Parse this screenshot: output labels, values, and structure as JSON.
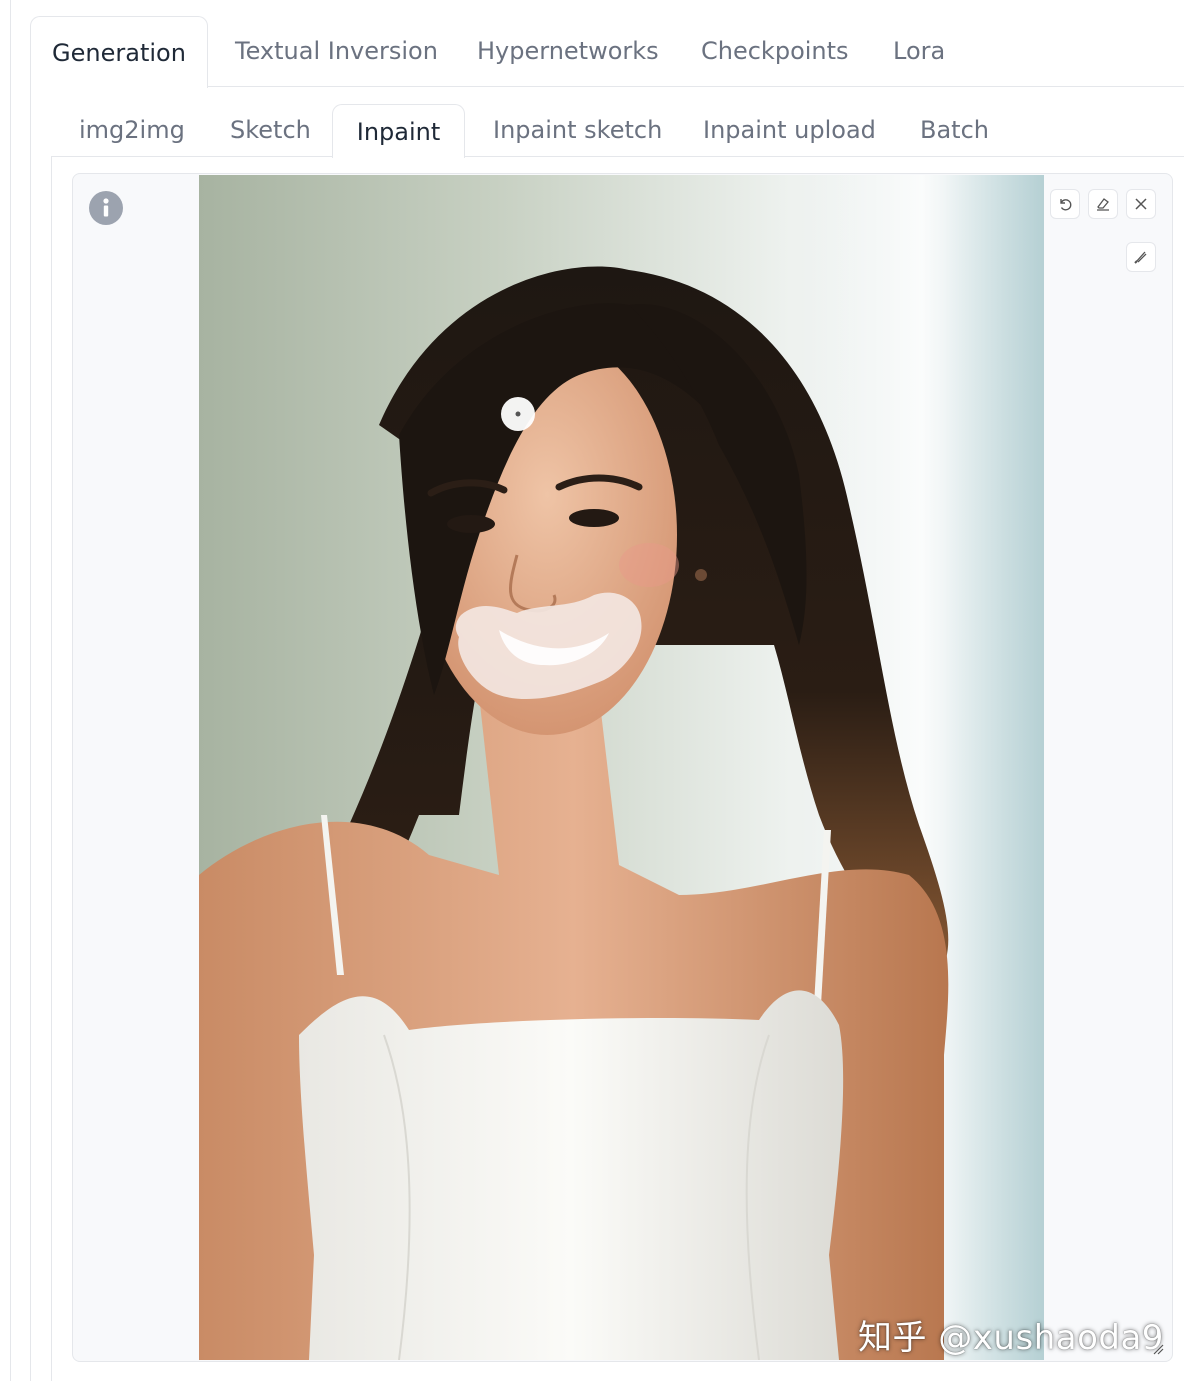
{
  "top_tabs": [
    {
      "label": "Generation",
      "active": true
    },
    {
      "label": "Textual Inversion",
      "active": false
    },
    {
      "label": "Hypernetworks",
      "active": false
    },
    {
      "label": "Checkpoints",
      "active": false
    },
    {
      "label": "Lora",
      "active": false
    }
  ],
  "sub_tabs": [
    {
      "label": "img2img",
      "active": false
    },
    {
      "label": "Sketch",
      "active": false
    },
    {
      "label": "Inpaint",
      "active": true
    },
    {
      "label": "Inpaint sketch",
      "active": false
    },
    {
      "label": "Inpaint upload",
      "active": false
    },
    {
      "label": "Batch",
      "active": false
    }
  ],
  "editor": {
    "toolbar_icons": [
      "undo-icon",
      "eraser-icon",
      "close-icon"
    ],
    "brush_icon": "brush-icon",
    "info_icon": "info-icon"
  },
  "watermark": "知乎 @xushaoda9",
  "colors": {
    "active_text": "#1f2937",
    "inactive_text": "#6b7280",
    "border": "#e5e7eb",
    "mask_overlay": "#f3e6e1"
  }
}
